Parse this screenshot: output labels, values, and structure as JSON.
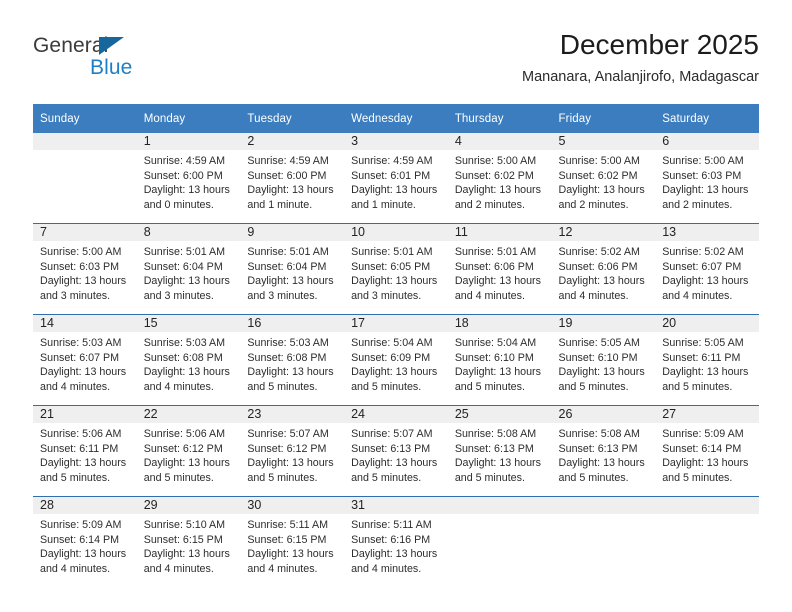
{
  "brand": {
    "name_top": "General",
    "name_bottom": "Blue",
    "accent_color": "#17679f",
    "blue_text_color": "#1f7fc4"
  },
  "header": {
    "title": "December 2025",
    "subtitle": "Mananara, Analanjirofo, Madagascar"
  },
  "theme": {
    "header_row_bg": "#3c7dbf",
    "daynum_band_bg": "#efefef",
    "row_divider": "#2f6fad",
    "text_color": "#2d2d2d"
  },
  "weekdays": [
    "Sunday",
    "Monday",
    "Tuesday",
    "Wednesday",
    "Thursday",
    "Friday",
    "Saturday"
  ],
  "weeks": [
    [
      {
        "day": "",
        "lines": []
      },
      {
        "day": "1",
        "lines": [
          "Sunrise: 4:59 AM",
          "Sunset: 6:00 PM",
          "Daylight: 13 hours",
          "and 0 minutes."
        ]
      },
      {
        "day": "2",
        "lines": [
          "Sunrise: 4:59 AM",
          "Sunset: 6:00 PM",
          "Daylight: 13 hours",
          "and 1 minute."
        ]
      },
      {
        "day": "3",
        "lines": [
          "Sunrise: 4:59 AM",
          "Sunset: 6:01 PM",
          "Daylight: 13 hours",
          "and 1 minute."
        ]
      },
      {
        "day": "4",
        "lines": [
          "Sunrise: 5:00 AM",
          "Sunset: 6:02 PM",
          "Daylight: 13 hours",
          "and 2 minutes."
        ]
      },
      {
        "day": "5",
        "lines": [
          "Sunrise: 5:00 AM",
          "Sunset: 6:02 PM",
          "Daylight: 13 hours",
          "and 2 minutes."
        ]
      },
      {
        "day": "6",
        "lines": [
          "Sunrise: 5:00 AM",
          "Sunset: 6:03 PM",
          "Daylight: 13 hours",
          "and 2 minutes."
        ]
      }
    ],
    [
      {
        "day": "7",
        "lines": [
          "Sunrise: 5:00 AM",
          "Sunset: 6:03 PM",
          "Daylight: 13 hours",
          "and 3 minutes."
        ]
      },
      {
        "day": "8",
        "lines": [
          "Sunrise: 5:01 AM",
          "Sunset: 6:04 PM",
          "Daylight: 13 hours",
          "and 3 minutes."
        ]
      },
      {
        "day": "9",
        "lines": [
          "Sunrise: 5:01 AM",
          "Sunset: 6:04 PM",
          "Daylight: 13 hours",
          "and 3 minutes."
        ]
      },
      {
        "day": "10",
        "lines": [
          "Sunrise: 5:01 AM",
          "Sunset: 6:05 PM",
          "Daylight: 13 hours",
          "and 3 minutes."
        ]
      },
      {
        "day": "11",
        "lines": [
          "Sunrise: 5:01 AM",
          "Sunset: 6:06 PM",
          "Daylight: 13 hours",
          "and 4 minutes."
        ]
      },
      {
        "day": "12",
        "lines": [
          "Sunrise: 5:02 AM",
          "Sunset: 6:06 PM",
          "Daylight: 13 hours",
          "and 4 minutes."
        ]
      },
      {
        "day": "13",
        "lines": [
          "Sunrise: 5:02 AM",
          "Sunset: 6:07 PM",
          "Daylight: 13 hours",
          "and 4 minutes."
        ]
      }
    ],
    [
      {
        "day": "14",
        "lines": [
          "Sunrise: 5:03 AM",
          "Sunset: 6:07 PM",
          "Daylight: 13 hours",
          "and 4 minutes."
        ]
      },
      {
        "day": "15",
        "lines": [
          "Sunrise: 5:03 AM",
          "Sunset: 6:08 PM",
          "Daylight: 13 hours",
          "and 4 minutes."
        ]
      },
      {
        "day": "16",
        "lines": [
          "Sunrise: 5:03 AM",
          "Sunset: 6:08 PM",
          "Daylight: 13 hours",
          "and 5 minutes."
        ]
      },
      {
        "day": "17",
        "lines": [
          "Sunrise: 5:04 AM",
          "Sunset: 6:09 PM",
          "Daylight: 13 hours",
          "and 5 minutes."
        ]
      },
      {
        "day": "18",
        "lines": [
          "Sunrise: 5:04 AM",
          "Sunset: 6:10 PM",
          "Daylight: 13 hours",
          "and 5 minutes."
        ]
      },
      {
        "day": "19",
        "lines": [
          "Sunrise: 5:05 AM",
          "Sunset: 6:10 PM",
          "Daylight: 13 hours",
          "and 5 minutes."
        ]
      },
      {
        "day": "20",
        "lines": [
          "Sunrise: 5:05 AM",
          "Sunset: 6:11 PM",
          "Daylight: 13 hours",
          "and 5 minutes."
        ]
      }
    ],
    [
      {
        "day": "21",
        "lines": [
          "Sunrise: 5:06 AM",
          "Sunset: 6:11 PM",
          "Daylight: 13 hours",
          "and 5 minutes."
        ]
      },
      {
        "day": "22",
        "lines": [
          "Sunrise: 5:06 AM",
          "Sunset: 6:12 PM",
          "Daylight: 13 hours",
          "and 5 minutes."
        ]
      },
      {
        "day": "23",
        "lines": [
          "Sunrise: 5:07 AM",
          "Sunset: 6:12 PM",
          "Daylight: 13 hours",
          "and 5 minutes."
        ]
      },
      {
        "day": "24",
        "lines": [
          "Sunrise: 5:07 AM",
          "Sunset: 6:13 PM",
          "Daylight: 13 hours",
          "and 5 minutes."
        ]
      },
      {
        "day": "25",
        "lines": [
          "Sunrise: 5:08 AM",
          "Sunset: 6:13 PM",
          "Daylight: 13 hours",
          "and 5 minutes."
        ]
      },
      {
        "day": "26",
        "lines": [
          "Sunrise: 5:08 AM",
          "Sunset: 6:13 PM",
          "Daylight: 13 hours",
          "and 5 minutes."
        ]
      },
      {
        "day": "27",
        "lines": [
          "Sunrise: 5:09 AM",
          "Sunset: 6:14 PM",
          "Daylight: 13 hours",
          "and 5 minutes."
        ]
      }
    ],
    [
      {
        "day": "28",
        "lines": [
          "Sunrise: 5:09 AM",
          "Sunset: 6:14 PM",
          "Daylight: 13 hours",
          "and 4 minutes."
        ]
      },
      {
        "day": "29",
        "lines": [
          "Sunrise: 5:10 AM",
          "Sunset: 6:15 PM",
          "Daylight: 13 hours",
          "and 4 minutes."
        ]
      },
      {
        "day": "30",
        "lines": [
          "Sunrise: 5:11 AM",
          "Sunset: 6:15 PM",
          "Daylight: 13 hours",
          "and 4 minutes."
        ]
      },
      {
        "day": "31",
        "lines": [
          "Sunrise: 5:11 AM",
          "Sunset: 6:16 PM",
          "Daylight: 13 hours",
          "and 4 minutes."
        ]
      },
      {
        "day": "",
        "lines": []
      },
      {
        "day": "",
        "lines": []
      },
      {
        "day": "",
        "lines": []
      }
    ]
  ]
}
